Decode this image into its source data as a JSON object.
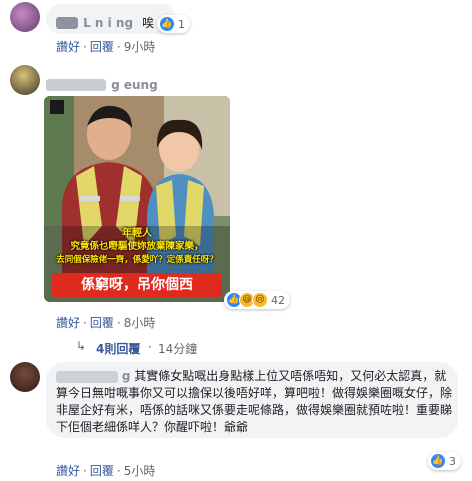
{
  "comments": [
    {
      "name": "L   n  i  ng",
      "text": "唉",
      "reactions": {
        "count": "1",
        "icons": [
          "like-icon"
        ]
      },
      "actions": {
        "like": "讚好",
        "reply": "回覆",
        "time": "9小時"
      }
    },
    {
      "name": "  g   eung",
      "photo_caption": {
        "line1": "年輕人",
        "line2": "究竟係乜嘢驅使妳放棄陳家樂，",
        "line3": "去同個保險佬一齊，係愛吖？定係責任呀？",
        "big": "係窮呀，吊你個西"
      },
      "reactions": {
        "count": "42",
        "icons": [
          "like-icon",
          "haha-icon",
          "sad-icon"
        ]
      },
      "actions": {
        "like": "讚好",
        "reply": "回覆",
        "time": "8小時"
      }
    },
    {
      "replies": {
        "label": "4則回覆",
        "time": "14分鐘"
      }
    },
    {
      "name": "        g",
      "text": "其實條女點嘅出身點樣上位又唔係唔知，又何必太認真，就算今日無咁嘅事你又可以擔保以後唔好咩，算吧啦！做得娛樂圈嘅女仔，除非屋企好有米，唔係的話咪又係要走呢條路，做得娛樂圈就預咗啦！重要睇下佢個老細係咩人？你醒吓啦！爺爺",
      "reactions": {
        "count": "3",
        "icons": [
          "like-icon"
        ]
      },
      "actions": {
        "like": "讚好",
        "reply": "回覆",
        "time": "5小時"
      }
    }
  ],
  "colors": {
    "link": "#385898",
    "bubble": "#f2f3f5",
    "muted": "#606770",
    "caption_yellow": "#ffe600",
    "caption_red": "#e02a1e"
  }
}
